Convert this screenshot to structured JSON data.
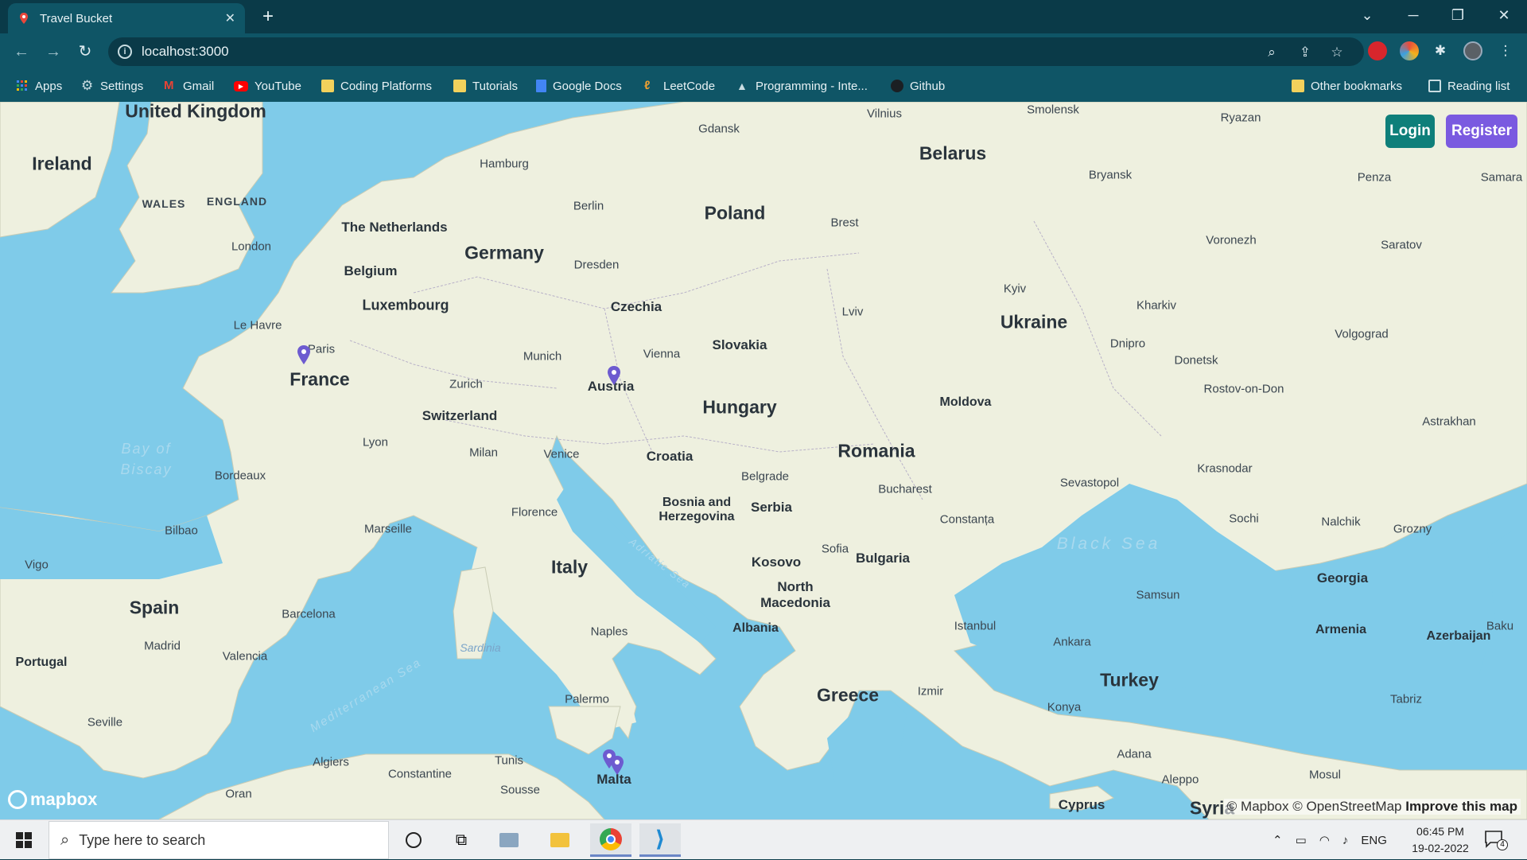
{
  "browser": {
    "tab_title": "Travel Bucket",
    "url": "localhost:3000",
    "bookmarks": [
      {
        "label": "Apps"
      },
      {
        "label": "Settings"
      },
      {
        "label": "Gmail"
      },
      {
        "label": "YouTube"
      },
      {
        "label": "Coding Platforms"
      },
      {
        "label": "Tutorials"
      },
      {
        "label": "Google Docs"
      },
      {
        "label": "LeetCode"
      },
      {
        "label": "Programming - Inte..."
      },
      {
        "label": "Github"
      }
    ],
    "other_bookmarks": "Other bookmarks",
    "reading_list": "Reading list"
  },
  "app": {
    "login_label": "Login",
    "register_label": "Register",
    "accent_login": "#0e7f7a",
    "accent_register": "#7a5ae0"
  },
  "map": {
    "countries": [
      "United Kingdom",
      "Ireland",
      "The Netherlands",
      "Belgium",
      "Luxembourg",
      "Germany",
      "Poland",
      "Belarus",
      "Ukraine",
      "Czechia",
      "Slovakia",
      "Austria",
      "Hungary",
      "Moldova",
      "Romania",
      "France",
      "Switzerland",
      "Croatia",
      "Bosnia and Herzegovina",
      "Serbia",
      "Kosovo",
      "North Macedonia",
      "Albania",
      "Bulgaria",
      "Italy",
      "Malta",
      "Greece",
      "Turkey",
      "Spain",
      "Portugal",
      "Georgia",
      "Armenia",
      "Azerbaijan",
      "Cyprus",
      "Syria"
    ],
    "regions": [
      "WALES",
      "ENGLAND"
    ],
    "cities": [
      "Gdansk",
      "Vilnius",
      "Smolensk",
      "Ryazan",
      "Hamburg",
      "Berlin",
      "Bryansk",
      "Penza",
      "Samara",
      "London",
      "Brest",
      "Voronezh",
      "Saratov",
      "Dresden",
      "Kyiv",
      "Le Havre",
      "Paris",
      "Lviv",
      "Kharkiv",
      "Munich",
      "Vienna",
      "Dnipro",
      "Volgograd",
      "Donetsk",
      "Zurich",
      "Rostov-on-Don",
      "Lyon",
      "Milan",
      "Venice",
      "Astrakhan",
      "Bordeaux",
      "Krasnodar",
      "Belgrade",
      "Bucharest",
      "Sevastopol",
      "Florence",
      "Constanța",
      "Bilbao",
      "Marseille",
      "Sochi",
      "Nalchik",
      "Grozny",
      "Vigo",
      "Sofia",
      "Samsun",
      "Barcelona",
      "Istanbul",
      "Baku",
      "Naples",
      "Ankara",
      "Madrid",
      "Valencia",
      "Izmir",
      "Tabriz",
      "Konya",
      "Palermo",
      "Seville",
      "Adana",
      "Algiers",
      "Tunis",
      "Constantine",
      "Mosul",
      "Aleppo",
      "Sousse",
      "Oran"
    ],
    "seas": [
      "Bay of Biscay",
      "Black Sea",
      "Adriatic Sea",
      "Mediterranean Sea"
    ],
    "islands": [
      "Sardinia"
    ],
    "attribution": "© Mapbox © OpenStreetMap",
    "improve_label": "Improve this map",
    "logo": "mapbox",
    "land_color": "#eef0df",
    "water_color": "#7fcbe9",
    "marker_color": "#6d5bd0"
  },
  "taskbar": {
    "search_placeholder": "Type here to search",
    "language": "ENG",
    "time": "06:45 PM",
    "date": "19-02-2022",
    "notifications": "4"
  }
}
